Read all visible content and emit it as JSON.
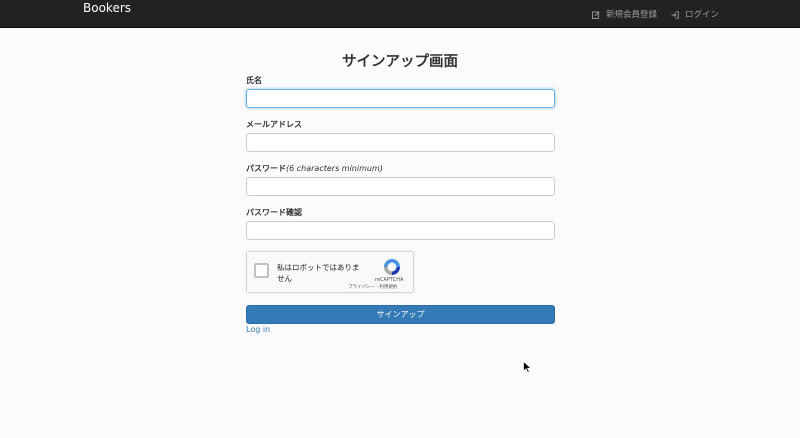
{
  "navbar": {
    "brand": "Bookers",
    "items": [
      {
        "label": "新規会員登録",
        "icon": "edit-icon"
      },
      {
        "label": "ログイン",
        "icon": "login-icon"
      }
    ],
    "background": "#222222"
  },
  "page_title": "サインアップ画面",
  "form": {
    "name_label": "氏名",
    "name_value": "",
    "email_label": "メールアドレス",
    "email_value": "",
    "password_label": "パスワード",
    "password_hint": "(6 characters minimum)",
    "password_value": "",
    "password_confirm_label": "パスワード確認",
    "password_confirm_value": ""
  },
  "captcha": {
    "checkbox_label": "私はロボットではありません",
    "brand": "reCAPTCHA",
    "links": "プライバシー - 利用規約"
  },
  "submit_label": "サインアップ",
  "login_link": "Log in",
  "colors": {
    "primary": "#337ab7",
    "focus": "#66afe9"
  }
}
